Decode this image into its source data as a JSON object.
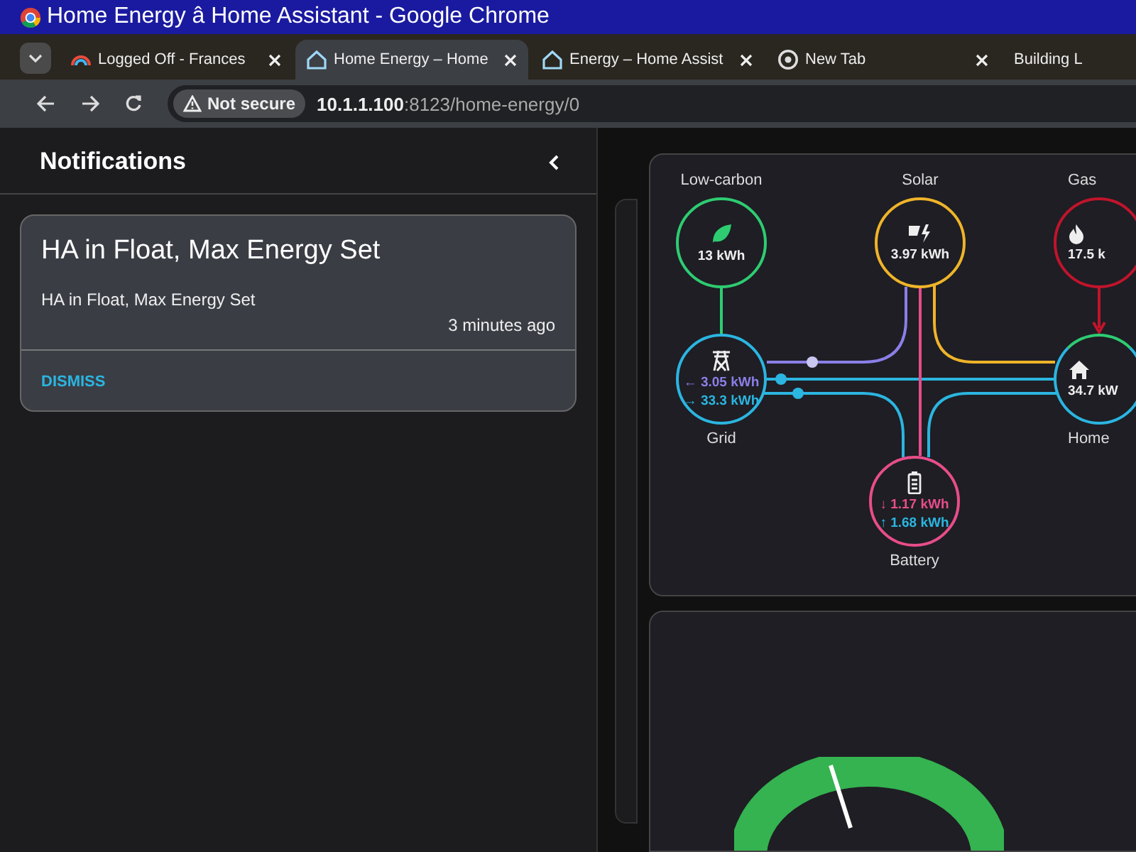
{
  "window": {
    "title": "Home Energy â Home Assistant - Google Chrome"
  },
  "tabs": [
    {
      "label": "Logged Off - Frances",
      "selected": false,
      "kind": "rainbow"
    },
    {
      "label": "Home Energy – Home",
      "selected": true,
      "kind": "home"
    },
    {
      "label": "Energy – Home Assist",
      "selected": false,
      "kind": "home"
    },
    {
      "label": "New Tab",
      "selected": false,
      "kind": "chrome"
    },
    {
      "label": "Building L",
      "selected": false,
      "kind": "plain"
    }
  ],
  "address_bar": {
    "security": "Not secure",
    "host": "10.1.1.100",
    "path": ":8123/home-energy/0"
  },
  "notifications": {
    "title": "Notifications",
    "items": [
      {
        "title": "HA in Float, Max Energy Set",
        "message": "HA in Float, Max Energy Set",
        "time": "3 minutes ago",
        "action": "DISMISS"
      }
    ]
  },
  "energy_distribution": {
    "nodes": [
      {
        "kind": "low_carbon",
        "label": "Low-carbon",
        "color": "#2ecc71",
        "readings": [
          {
            "value": "13 kWh"
          }
        ]
      },
      {
        "kind": "solar",
        "label": "Solar",
        "color": "#f0b429",
        "readings": [
          {
            "value": "3.97 kWh"
          }
        ]
      },
      {
        "kind": "gas",
        "label": "Gas",
        "color": "#c0142c",
        "readings": [
          {
            "value": "17.5 k"
          }
        ]
      },
      {
        "kind": "grid",
        "label": "Grid",
        "color": "#2bb5e0",
        "readings": [
          {
            "arrow": "←",
            "value": "3.05 kWh",
            "color": "#8b7fe8"
          },
          {
            "arrow": "→",
            "value": "33.3 kWh",
            "color": "#2bb5e0"
          }
        ]
      },
      {
        "kind": "home",
        "label": "Home",
        "color": "#2bb5e0",
        "readings": [
          {
            "value": "34.7 kW"
          }
        ]
      },
      {
        "kind": "battery",
        "label": "Battery",
        "color": "#e84d8a",
        "readings": [
          {
            "arrow": "↓",
            "value": "1.17 kWh",
            "color": "#e84d8a"
          },
          {
            "arrow": "↑",
            "value": "1.68 kWh",
            "color": "#2bb5e0"
          }
        ]
      }
    ]
  }
}
